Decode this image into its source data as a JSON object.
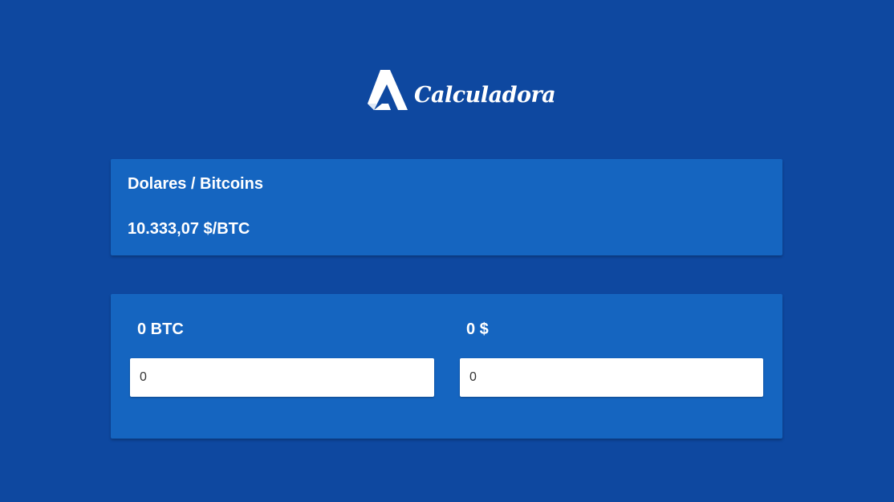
{
  "header": {
    "logo_text": "Calculadora"
  },
  "rate_card": {
    "title": "Dolares / Bitcoins",
    "value": "10.333,07 $/BTC"
  },
  "converter": {
    "btc_label": "0 BTC",
    "usd_label": "0 $",
    "btc_input_value": "0",
    "usd_input_value": "0"
  },
  "colors": {
    "background": "#0e48a0",
    "card": "#1565c0",
    "text": "#ffffff"
  }
}
